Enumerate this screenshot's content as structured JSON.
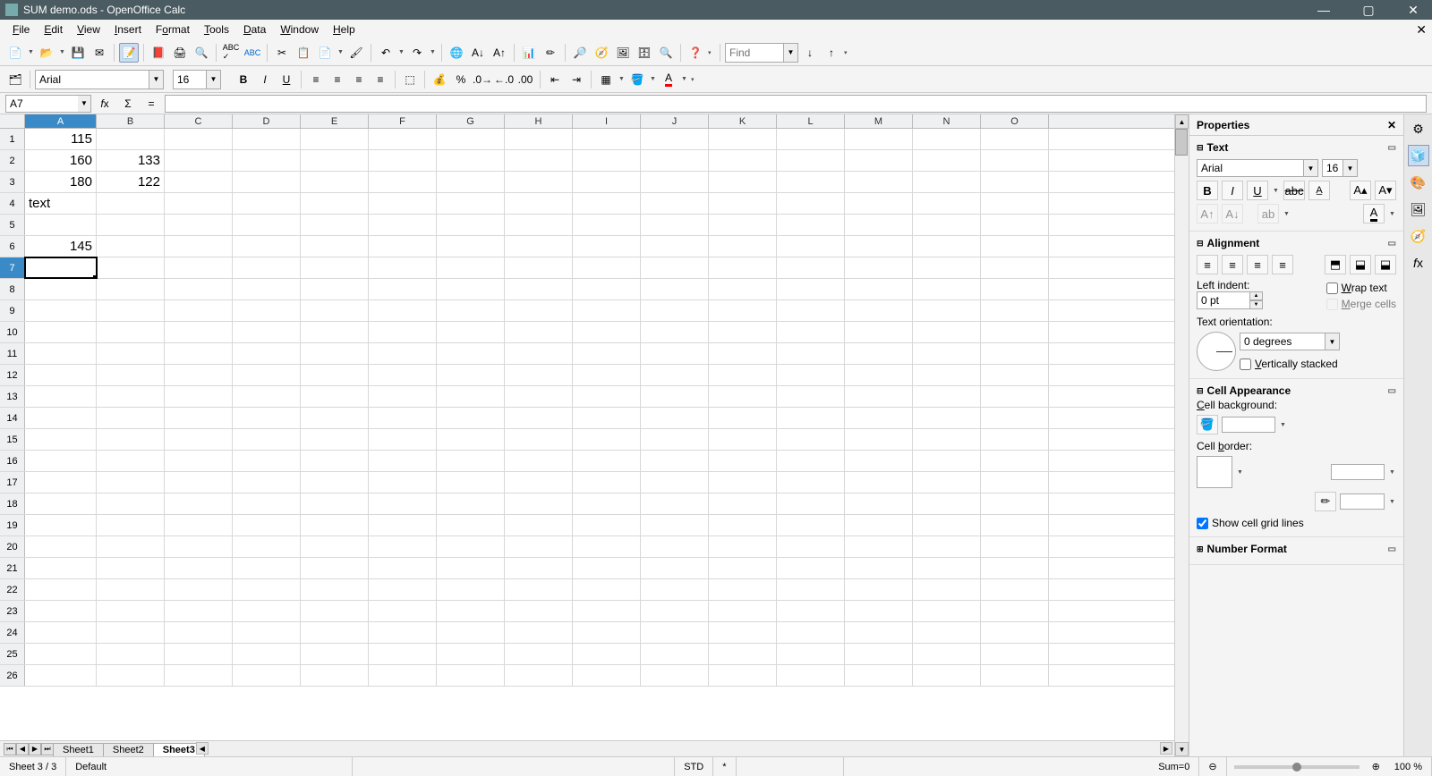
{
  "title": "SUM demo.ods - OpenOffice Calc",
  "menu": [
    "File",
    "Edit",
    "View",
    "Insert",
    "Format",
    "Tools",
    "Data",
    "Window",
    "Help"
  ],
  "toolbar": {
    "find_placeholder": "Find"
  },
  "format": {
    "font_name": "Arial",
    "font_size": "16"
  },
  "namebox": "A7",
  "formula": "",
  "columns": [
    "A",
    "B",
    "C",
    "D",
    "E",
    "F",
    "G",
    "H",
    "I",
    "J",
    "K",
    "L",
    "M",
    "N",
    "O"
  ],
  "row_count": 26,
  "selected": {
    "row": 7,
    "col": "A"
  },
  "cells": {
    "A1": {
      "v": "115",
      "t": "num"
    },
    "A2": {
      "v": "160",
      "t": "num"
    },
    "B2": {
      "v": "133",
      "t": "num"
    },
    "A3": {
      "v": "180",
      "t": "num"
    },
    "B3": {
      "v": "122",
      "t": "num"
    },
    "A4": {
      "v": "text",
      "t": "txt"
    },
    "A6": {
      "v": "145",
      "t": "num"
    }
  },
  "sheets": {
    "tabs": [
      "Sheet1",
      "Sheet2",
      "Sheet3"
    ],
    "active": "Sheet3"
  },
  "properties": {
    "title": "Properties",
    "text_section": "Text",
    "alignment_section": "Alignment",
    "left_indent_label": "Left indent:",
    "left_indent_value": "0 pt",
    "wrap_text_label": "Wrap text",
    "merge_cells_label": "Merge cells",
    "text_orientation_label": "Text orientation:",
    "orientation_value": "0 degrees",
    "vertically_stacked_label": "Vertically stacked",
    "cell_appearance_section": "Cell Appearance",
    "cell_background_label": "Cell background:",
    "cell_border_label": "Cell border:",
    "show_gridlines_label": "Show cell grid lines",
    "number_format_section": "Number Format",
    "font_name": "Arial",
    "font_size": "16"
  },
  "status": {
    "sheet_info": "Sheet 3 / 3",
    "pagestyle": "Default",
    "mode": "STD",
    "modified": "*",
    "sum": "Sum=0",
    "zoom": "100 %"
  }
}
